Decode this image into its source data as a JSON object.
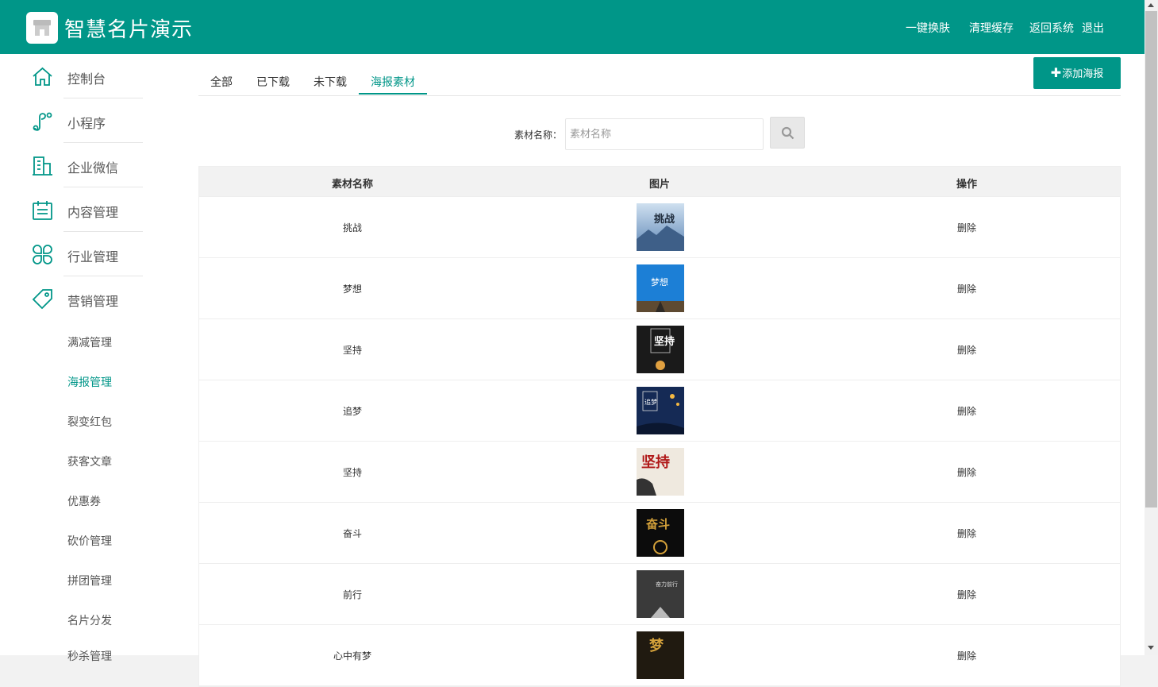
{
  "header": {
    "title": "智慧名片演示",
    "nav": [
      "一键换肤",
      "清理缓存",
      "返回系统",
      "退出"
    ]
  },
  "sidebar": {
    "items": [
      {
        "label": "控制台",
        "icon": "home-icon"
      },
      {
        "label": "小程序",
        "icon": "miniprogram-icon"
      },
      {
        "label": "企业微信",
        "icon": "building-icon"
      },
      {
        "label": "内容管理",
        "icon": "calendar-list-icon"
      },
      {
        "label": "行业管理",
        "icon": "clover-icon"
      },
      {
        "label": "营销管理",
        "icon": "tag-icon"
      }
    ],
    "sub_items": [
      "满减管理",
      "海报管理",
      "裂变红包",
      "获客文章",
      "优惠券",
      "砍价管理",
      "拼团管理",
      "名片分发",
      "秒杀管理"
    ],
    "active_sub": "海报管理"
  },
  "tabs": [
    "全部",
    "已下载",
    "未下载",
    "海报素材"
  ],
  "active_tab": "海报素材",
  "add_button": {
    "label": "添加海报"
  },
  "search": {
    "label": "素材名称：",
    "placeholder": "素材名称"
  },
  "table": {
    "headers": [
      "素材名称",
      "图片",
      "操作"
    ],
    "rows": [
      {
        "name": "挑战",
        "action": "删除",
        "thumb_text": "挑战"
      },
      {
        "name": "梦想",
        "action": "删除",
        "thumb_text": "梦想"
      },
      {
        "name": "坚持",
        "action": "删除",
        "thumb_text": "坚持"
      },
      {
        "name": "追梦",
        "action": "删除",
        "thumb_text": "追梦"
      },
      {
        "name": "坚持",
        "action": "删除",
        "thumb_text": "坚持"
      },
      {
        "name": "奋斗",
        "action": "删除",
        "thumb_text": "奋斗"
      },
      {
        "name": "前行",
        "action": "删除",
        "thumb_text": "奋力前行"
      },
      {
        "name": "心中有梦",
        "action": "删除",
        "thumb_text": "梦"
      }
    ]
  },
  "colors": {
    "primary": "#009688",
    "topbar": "#009688"
  }
}
